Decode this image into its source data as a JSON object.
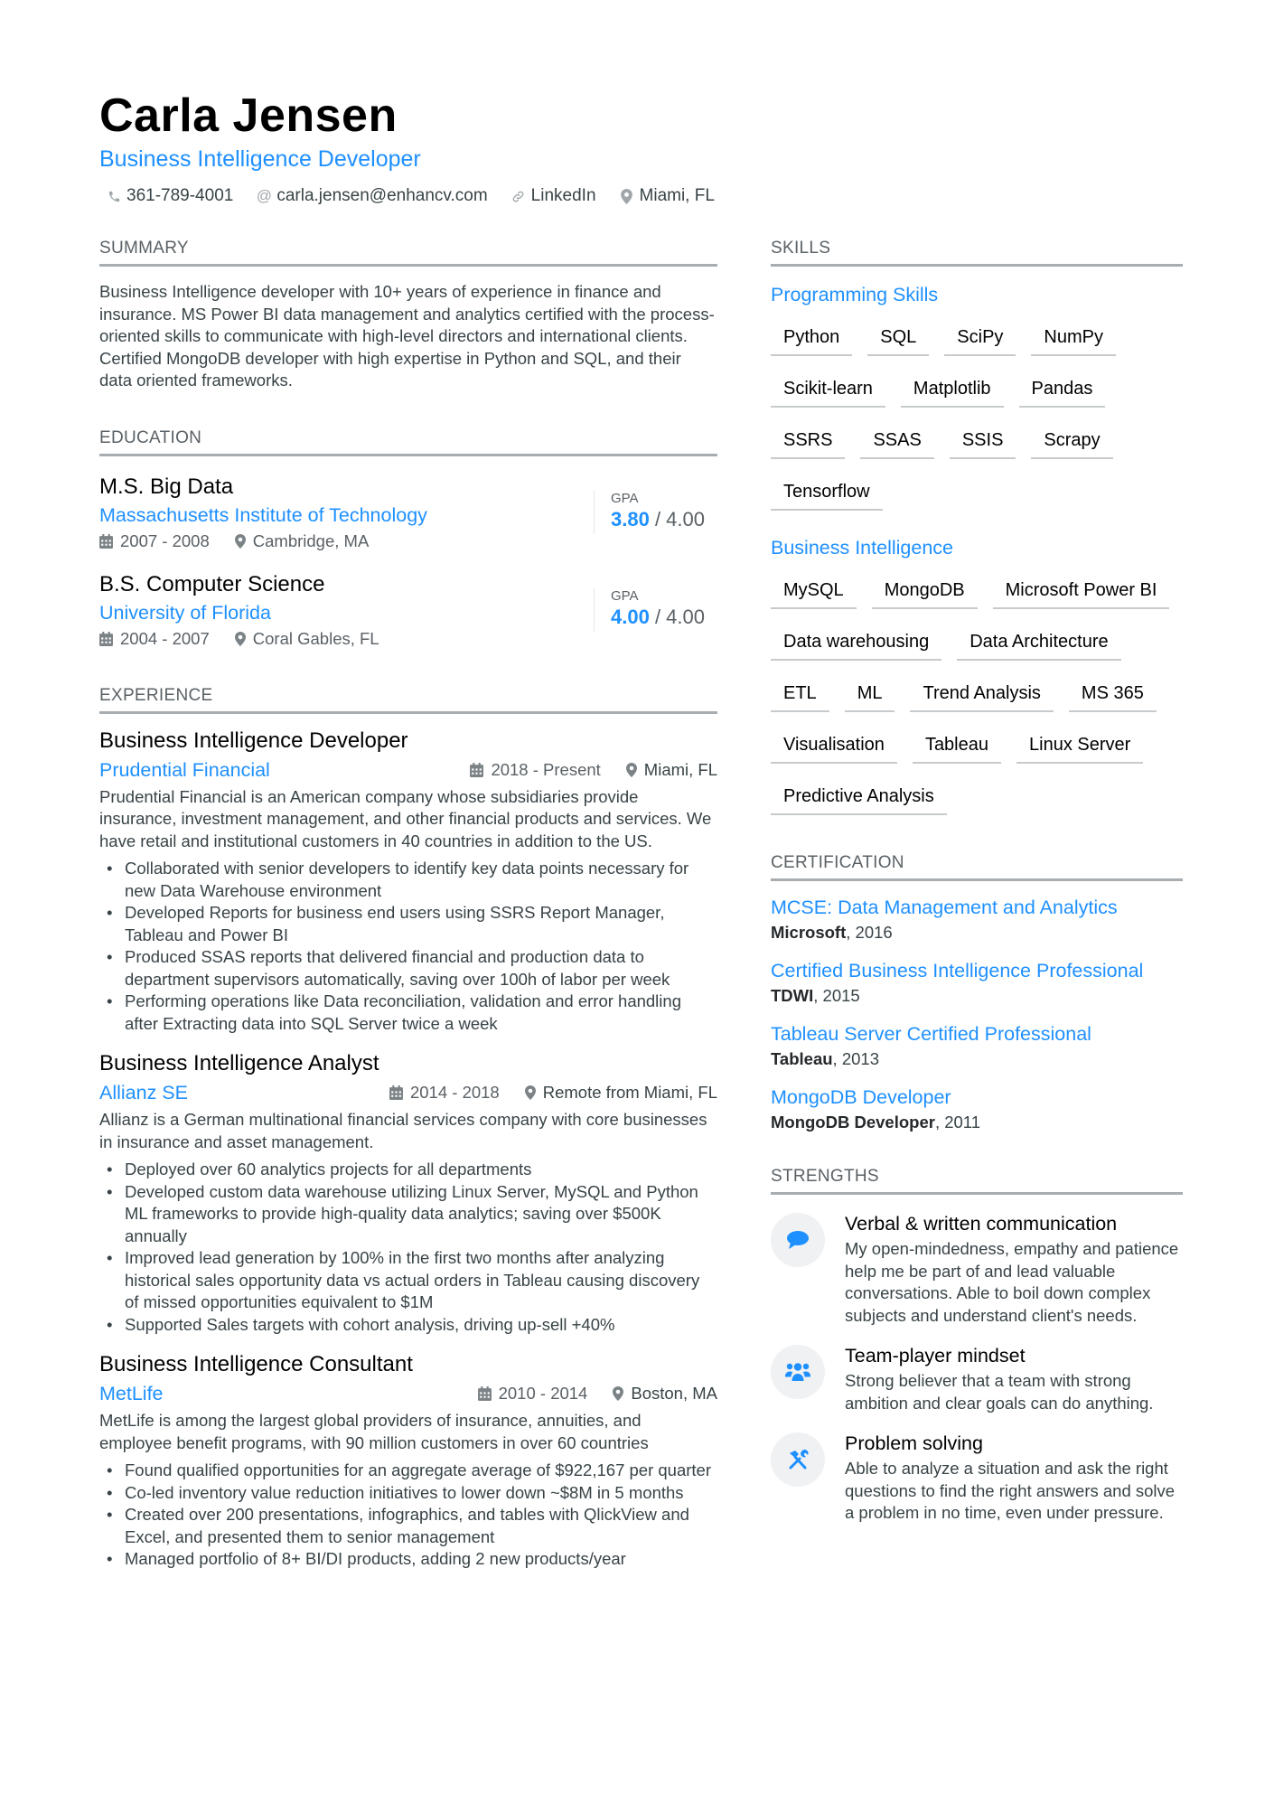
{
  "header": {
    "name": "Carla Jensen",
    "title": "Business Intelligence Developer",
    "contacts": [
      {
        "icon": "phone-icon",
        "text": "361-789-4001"
      },
      {
        "icon": "at-icon",
        "text": "carla.jensen@enhancv.com"
      },
      {
        "icon": "link-icon",
        "text": "LinkedIn"
      },
      {
        "icon": "location-icon",
        "text": "Miami, FL"
      }
    ]
  },
  "summary": {
    "heading": "SUMMARY",
    "text": "Business Intelligence developer with 10+ years of experience in finance and insurance. MS Power BI data management and analytics certified with the process-oriented skills to communicate with high-level directors and international clients. Certified MongoDB developer with high expertise in Python and SQL, and their data oriented frameworks."
  },
  "education": {
    "heading": "EDUCATION",
    "items": [
      {
        "degree": "M.S. Big Data",
        "school": "Massachusetts Institute of Technology",
        "dates": "2007 - 2008",
        "location": "Cambridge, MA",
        "gpa_label": "GPA",
        "gpa": "3.80",
        "gpa_max": " / 4.00"
      },
      {
        "degree": "B.S. Computer Science",
        "school": "University of Florida",
        "dates": "2004 - 2007",
        "location": "Coral Gables, FL",
        "gpa_label": "GPA",
        "gpa": "4.00",
        "gpa_max": " / 4.00"
      }
    ]
  },
  "experience": {
    "heading": "EXPERIENCE",
    "items": [
      {
        "role": "Business Intelligence Developer",
        "company": "Prudential Financial",
        "dates": "2018 - Present",
        "location": "Miami, FL",
        "description": "Prudential Financial is an American company whose subsidiaries provide insurance, investment management, and other financial products and services. We have retail and institutional customers in 40 countries in addition to the US.",
        "bullets": [
          "Collaborated with senior developers to identify key data points necessary for new Data Warehouse environment",
          "Developed Reports for business end users using SSRS Report Manager, Tableau and Power BI",
          "Produced SSAS reports that delivered financial and production data to department supervisors automatically, saving over 100h of labor per week",
          "Performing operations like Data reconciliation, validation and error handling after Extracting data into SQL Server twice a week"
        ]
      },
      {
        "role": "Business Intelligence Analyst",
        "company": "Allianz SE",
        "dates": "2014 - 2018",
        "location": "Remote from Miami, FL",
        "description": "Allianz is a German multinational financial services company with core businesses in insurance and asset management.",
        "bullets": [
          "Deployed over 60 analytics projects for all departments",
          "Developed custom data warehouse utilizing Linux Server, MySQL and Python ML frameworks to provide high-quality data analytics; saving over $500K annually",
          "Improved lead generation by 100% in the first two months after analyzing historical sales opportunity data vs actual orders in Tableau causing discovery of missed opportunities equivalent to $1M",
          "Supported Sales targets with cohort analysis, driving up-sell +40%"
        ]
      },
      {
        "role": "Business Intelligence Consultant",
        "company": "MetLife",
        "dates": "2010 - 2014",
        "location": "Boston, MA",
        "description": "MetLife is among the largest global providers of insurance, annuities, and employee benefit programs, with 90 million customers in over 60 countries",
        "bullets": [
          "Found qualified opportunities for an aggregate average of $922,167 per quarter",
          "Co-led inventory value reduction initiatives to lower down ~$8M in 5 months",
          "Created over 200 presentations, infographics, and tables with QlickView and Excel, and presented them to senior management",
          "Managed portfolio of 8+ BI/DI products, adding 2 new products/year"
        ]
      }
    ]
  },
  "skills": {
    "heading": "SKILLS",
    "groups": [
      {
        "title": "Programming Skills",
        "tags": [
          "Python",
          "SQL",
          "SciPy",
          "NumPy",
          "Scikit-learn",
          "Matplotlib",
          "Pandas",
          "SSRS",
          "SSAS",
          "SSIS",
          "Scrapy",
          "Tensorflow"
        ]
      },
      {
        "title": "Business Intelligence",
        "tags": [
          "MySQL",
          "MongoDB",
          "Microsoft Power BI",
          "Data warehousing",
          "Data Architecture",
          "ETL",
          "ML",
          "Trend Analysis",
          "MS 365",
          "Visualisation",
          "Tableau",
          "Linux Server",
          "Predictive Analysis"
        ]
      }
    ]
  },
  "certification": {
    "heading": "CERTIFICATION",
    "items": [
      {
        "name": "MCSE: Data Management and Analytics",
        "issuer": "Microsoft",
        "year": ", 2016"
      },
      {
        "name": "Certified Business Intelligence Professional",
        "issuer": "TDWI",
        "year": ", 2015"
      },
      {
        "name": "Tableau Server Certified Professional",
        "issuer": "Tableau",
        "year": ", 2013"
      },
      {
        "name": "MongoDB Developer",
        "issuer": "MongoDB Developer",
        "year": ", 2011"
      }
    ]
  },
  "strengths": {
    "heading": "STRENGTHS",
    "items": [
      {
        "icon": "speech-bubble-icon",
        "title": "Verbal & written communication",
        "description": "My open-mindedness, empathy and patience help me be part of and lead valuable conversations. Able to boil down complex subjects and understand client's needs."
      },
      {
        "icon": "team-icon",
        "title": "Team-player mindset",
        "description": "Strong believer that a team with strong ambition and clear goals can do anything."
      },
      {
        "icon": "tools-icon",
        "title": "Problem solving",
        "description": "Able to analyze a situation and ask the right questions to find the right answers and solve a problem in no time, even under pressure."
      }
    ]
  },
  "colors": {
    "accent": "#1e90ff",
    "text": "#384347",
    "heading": "#000000",
    "rule": "#a8adb1"
  }
}
